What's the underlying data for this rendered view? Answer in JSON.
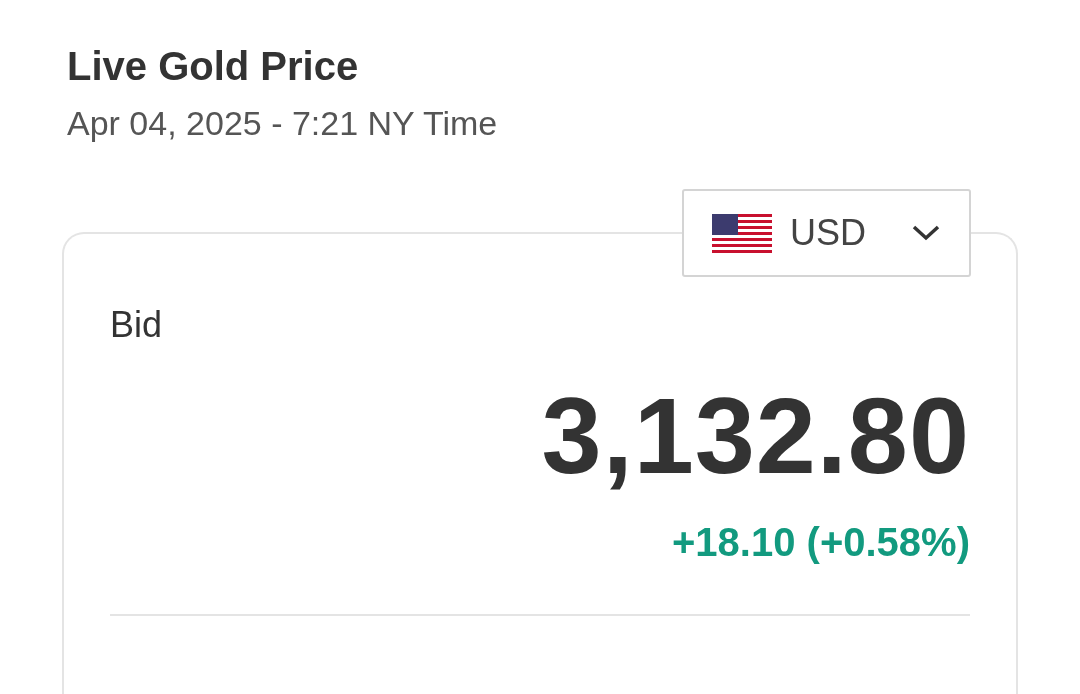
{
  "title": "Live Gold Price",
  "timestamp": "Apr 04, 2025 - 7:21 NY Time",
  "currency": {
    "code": "USD"
  },
  "quote": {
    "label": "Bid",
    "price": "3,132.80",
    "change": "+18.10 (+0.58%)",
    "rising": true
  }
}
